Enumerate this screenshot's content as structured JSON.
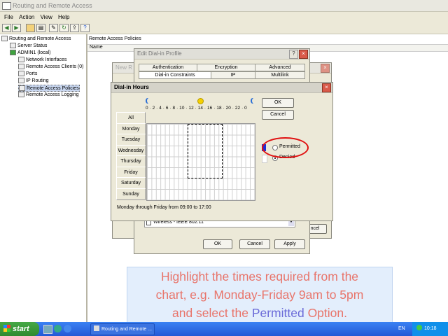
{
  "window": {
    "title": "Routing and Remote Access"
  },
  "menu": [
    "File",
    "Action",
    "View",
    "Help"
  ],
  "toolbar_icons": [
    "back-icon",
    "forward-icon",
    "up-folder-icon",
    "show-tree-icon",
    "properties-icon",
    "refresh-icon",
    "export-icon",
    "help-icon"
  ],
  "tree": {
    "items": [
      {
        "label": "Routing and Remote Access"
      },
      {
        "label": "Server Status"
      },
      {
        "label": "ADMIN1 (local)"
      },
      {
        "label": "Network Interfaces"
      },
      {
        "label": "Remote Access Clients (0)"
      },
      {
        "label": "Ports"
      },
      {
        "label": "IP Routing"
      },
      {
        "label": "Remote Access Policies"
      },
      {
        "label": "Remote Access Logging"
      }
    ],
    "selected_index": 7
  },
  "right_pane": {
    "header": "Remote Access Policies",
    "column": "Name"
  },
  "edit_profile": {
    "title": "Edit Dial-in Profile",
    "tabs_top": [
      "Authentication",
      "Encryption",
      "Advanced"
    ],
    "tabs_bottom": [
      "Dial-in Constraints",
      "IP",
      "Multilink"
    ],
    "media_item": "Wireless - IEEE 802.11",
    "buttons": {
      "ok": "OK",
      "cancel": "Cancel",
      "apply": "Apply"
    },
    "cancel_partial": "ncel"
  },
  "new_dialog": {
    "title_partial": "New R"
  },
  "dialin_hours": {
    "title": "Dial-in Hours",
    "hour_labels": "0 · 2 · 4 · 6 · 8 · 10 · 12 · 14 · 16 · 18 · 20 · 22 · 0",
    "days": [
      "All",
      "Monday",
      "Tuesday",
      "Wednesday",
      "Thursday",
      "Friday",
      "Saturday",
      "Sunday"
    ],
    "ok": "OK",
    "cancel": "Cancel",
    "permitted": "Permitted",
    "denied": "Denied",
    "summary": "Monday through Friday from 09:00 to 17:00"
  },
  "instruction": {
    "line1": "Highlight the times required from the",
    "line2": "chart, e.g. Monday-Friday 9am to 5pm",
    "line3_pre": "and select the ",
    "line3_highlight": "Permitted",
    "line3_post": " Option."
  },
  "taskbar": {
    "start": "start",
    "task": "Routing and Remote ...",
    "lang": "EN",
    "clock": "10:18"
  },
  "colors": {
    "highlight_circle": "#e01010",
    "instruction_text": "#e8746a",
    "instruction_highlight": "#6b6bd8"
  }
}
